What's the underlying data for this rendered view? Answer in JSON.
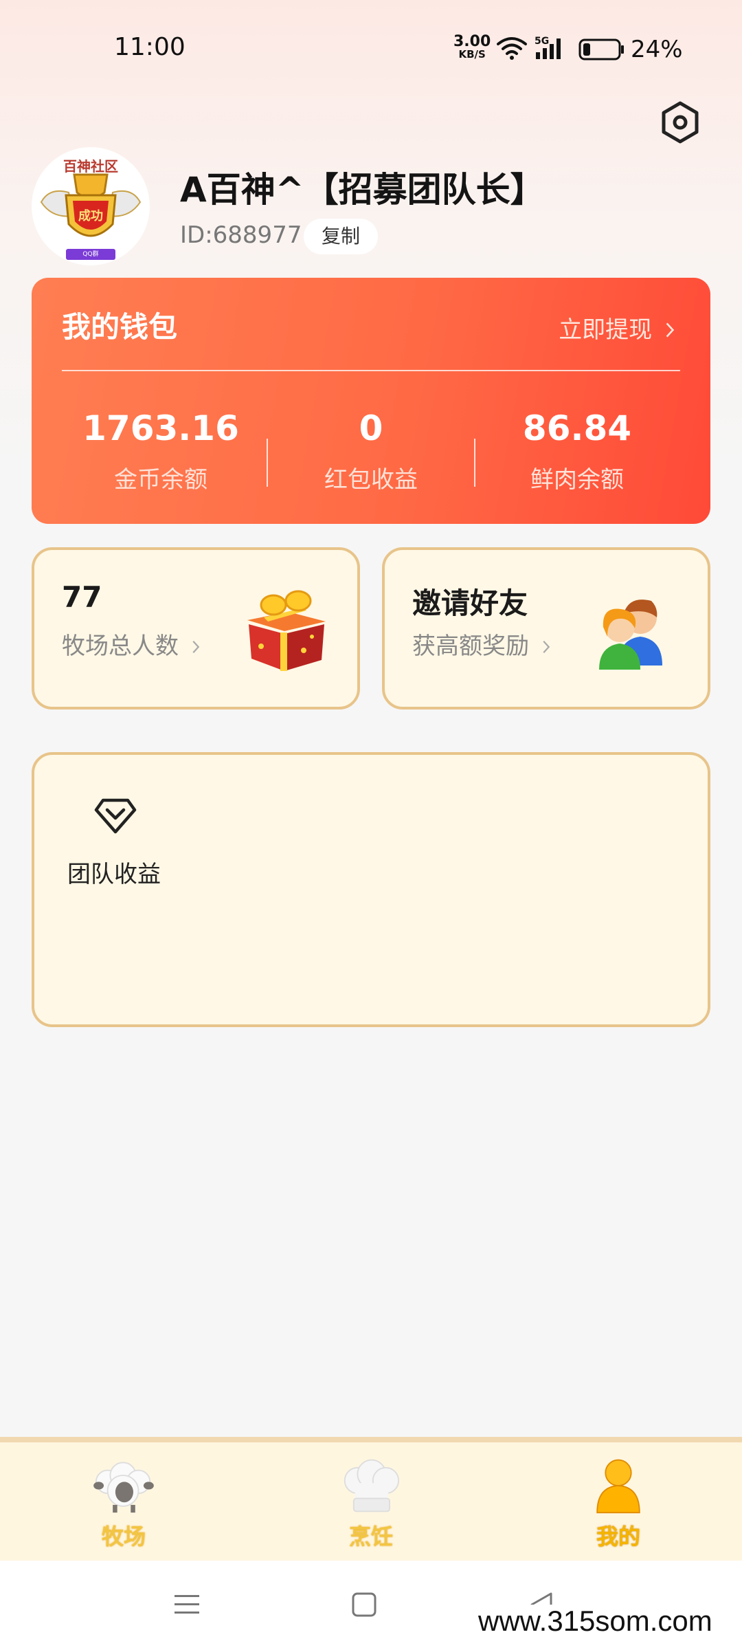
{
  "status_bar": {
    "time": "11:00",
    "net_speed_value": "3.00",
    "net_speed_unit": "KB/S",
    "battery": "24%"
  },
  "profile": {
    "avatar_top_text": "百神社区",
    "avatar_center_text": "成功",
    "avatar_bottom_text": "QQ群414383818",
    "username": "A百神^【招募团队长】",
    "id_text": "ID:688977",
    "copy_label": "复制"
  },
  "wallet": {
    "title": "我的钱包",
    "withdraw_label": "立即提现",
    "stats": [
      {
        "value": "1763.16",
        "label": "金币余额"
      },
      {
        "value": "0",
        "label": "红包收益"
      },
      {
        "value": "86.84",
        "label": "鲜肉余额"
      }
    ]
  },
  "cards": {
    "ranch": {
      "value": "77",
      "label": "牧场总人数"
    },
    "invite": {
      "title": "邀请好友",
      "label": "获高额奖励"
    },
    "team": {
      "label": "团队收益"
    }
  },
  "bottom_nav": {
    "items": [
      {
        "label": "牧场",
        "icon": "sheep-icon",
        "active": false
      },
      {
        "label": "烹饪",
        "icon": "chef-hat-icon",
        "active": false
      },
      {
        "label": "我的",
        "icon": "user-icon",
        "active": true
      }
    ]
  },
  "watermark": "www.315som.com",
  "colors": {
    "wallet_start": "#ff7e52",
    "wallet_end": "#ff4a38",
    "card_bg": "#fff8e6",
    "card_border": "#e8c48a",
    "nav_active": "#f5b400"
  }
}
